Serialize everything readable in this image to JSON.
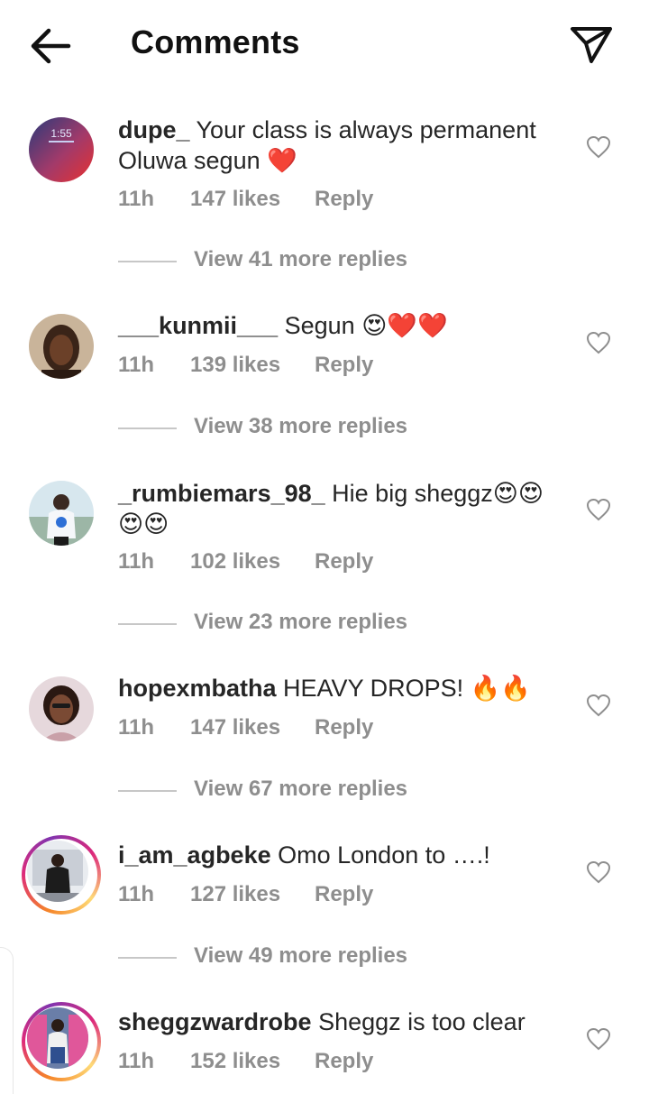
{
  "header": {
    "title": "Comments",
    "back_icon": "arrow-left-icon",
    "send_icon": "paper-plane-icon"
  },
  "colors": {
    "text": "#262626",
    "secondary": "#8e8e8e",
    "heart_red": "#e0245e",
    "story_ring": "#dd2a7b"
  },
  "comments": [
    {
      "username": "dupe_",
      "text": "Your class is always permanent Oluwa segun ❤️",
      "time": "11h",
      "likes": "147 likes",
      "reply": "Reply",
      "view_replies": "View 41 more replies",
      "avatar_text": "1:55",
      "story_ring": false
    },
    {
      "username": "___kunmii___",
      "text": "Segun 😍❤️❤️",
      "time": "11h",
      "likes": "139 likes",
      "reply": "Reply",
      "view_replies": "View 38 more replies",
      "story_ring": false
    },
    {
      "username": "_rumbiemars_98_",
      "text": "Hie big sheggz😍😍😍😍",
      "time": "11h",
      "likes": "102 likes",
      "reply": "Reply",
      "view_replies": "View 23 more replies",
      "story_ring": false
    },
    {
      "username": "hopexmbatha",
      "text": "HEAVY DROPS! 🔥🔥",
      "time": "11h",
      "likes": "147 likes",
      "reply": "Reply",
      "view_replies": "View 67 more replies",
      "story_ring": false
    },
    {
      "username": "i_am_agbeke",
      "text": "Omo London to ….!",
      "time": "11h",
      "likes": "127 likes",
      "reply": "Reply",
      "view_replies": "View 49 more replies",
      "story_ring": true
    },
    {
      "username": "sheggzwardrobe",
      "text": "Sheggz is too clear",
      "time": "11h",
      "likes": "152 likes",
      "reply": "Reply",
      "story_ring": true
    }
  ]
}
